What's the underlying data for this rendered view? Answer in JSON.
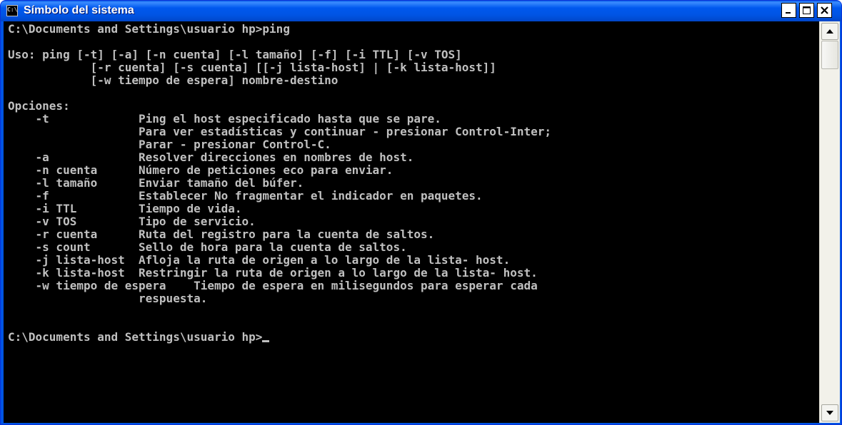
{
  "window": {
    "title": "Símbolo del sistema",
    "icon": "cmd-icon",
    "icon_glyph": "C:\\",
    "controls": {
      "minimize": "_",
      "maximize": "□",
      "close": "✕"
    }
  },
  "console": {
    "lines": [
      "C:\\Documents and Settings\\usuario hp>ping",
      "",
      "Uso: ping [-t] [-a] [-n cuenta] [-l tamaño] [-f] [-i TTL] [-v TOS]",
      "            [-r cuenta] [-s cuenta] [[-j lista-host] | [-k lista-host]]",
      "            [-w tiempo de espera] nombre-destino",
      "",
      "Opciones:",
      "    -t             Ping el host especificado hasta que se pare.",
      "                   Para ver estadísticas y continuar - presionar Control-Inter;",
      "                   Parar - presionar Control-C.",
      "    -a             Resolver direcciones en nombres de host.",
      "    -n cuenta      Número de peticiones eco para enviar.",
      "    -l tamaño      Enviar tamaño del búfer.",
      "    -f             Establecer No fragmentar el indicador en paquetes.",
      "    -i TTL         Tiempo de vida.",
      "    -v TOS         Tipo de servicio.",
      "    -r cuenta      Ruta del registro para la cuenta de saltos.",
      "    -s count       Sello de hora para la cuenta de saltos.",
      "    -j lista-host  Afloja la ruta de origen a lo largo de la lista- host.",
      "    -k lista-host  Restringir la ruta de origen a lo largo de la lista- host.",
      "    -w tiempo de espera    Tiempo de espera en milisegundos para esperar cada",
      "                   respuesta.",
      "",
      ""
    ],
    "prompt": "C:\\Documents and Settings\\usuario hp>"
  },
  "colors": {
    "titlebar": "#0054e3",
    "console_bg": "#000000",
    "console_fg": "#c0c0c0",
    "close_button": "#ffffff"
  }
}
